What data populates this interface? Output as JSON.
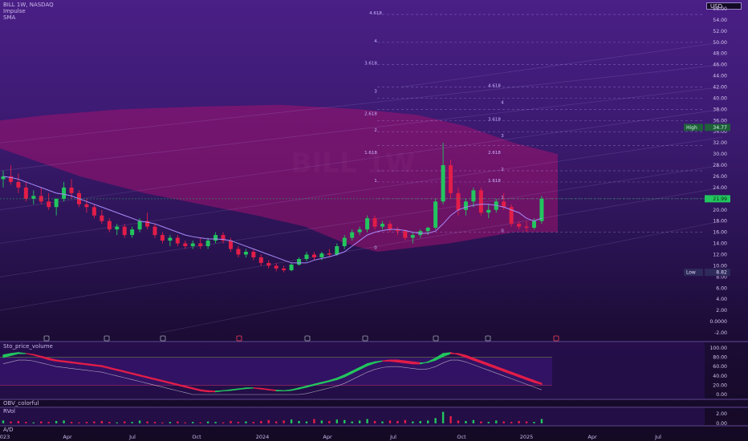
{
  "header": {
    "symbol": "BILL 1W, NASDAQ",
    "indicator1": "Impulse",
    "indicator2": "SMA",
    "currency": "USD"
  },
  "watermark": "BILL 1W",
  "colors": {
    "up": "#22c55e",
    "down": "#e11d48",
    "sma": "#a78bfa",
    "cloud": "#a1126f",
    "high_tag": "#1f5f3a",
    "last_tag": "#22c55e",
    "low_tag": "#2e2a5a"
  },
  "chart_data": [
    {
      "type": "candlestick",
      "title": "BILL 1W, NASDAQ",
      "ylim": [
        -2,
        56
      ],
      "y_ticks": [
        "56.00",
        "54.00",
        "52.00",
        "50.00",
        "48.00",
        "46.00",
        "44.00",
        "42.00",
        "40.00",
        "38.00",
        "36.00",
        "34.00",
        "32.00",
        "30.00",
        "28.00",
        "26.00",
        "24.00",
        "22.00",
        "20.00",
        "18.00",
        "16.00",
        "14.00",
        "12.00",
        "10.00",
        "8.00",
        "6.00",
        "4.00",
        "2.00",
        "0.0000",
        "-2.00"
      ],
      "x_ticks": [
        "023",
        "Apr",
        "Jul",
        "Oct",
        "2024",
        "Apr",
        "Jul",
        "Oct",
        "2025",
        "Apr",
        "Jul"
      ],
      "high": {
        "label": "High",
        "value": "34.77"
      },
      "last": {
        "value": "21.99"
      },
      "low": {
        "label": "Low",
        "value": "8.82"
      },
      "fib_labels": [
        "4.618",
        "4",
        "3.618",
        "3",
        "2.618",
        "2",
        "1.618",
        "1",
        "0",
        "4.618",
        "4",
        "3.618",
        "3",
        "2.618",
        "2",
        "1.618",
        "1",
        "0"
      ],
      "series": [
        {
          "name": "Price",
          "ohlc": [
            [
              25.5,
              27,
              24,
              26
            ],
            [
              26,
              28,
              24.5,
              25
            ],
            [
              25,
              26.5,
              23,
              24
            ],
            [
              24,
              25,
              21.5,
              22
            ],
            [
              22,
              23.5,
              21,
              22.5
            ],
            [
              22.5,
              24,
              21,
              21.5
            ],
            [
              21.5,
              23,
              20,
              20.5
            ],
            [
              20.5,
              22,
              19,
              22
            ],
            [
              22,
              25,
              21.5,
              24
            ],
            [
              24,
              25.5,
              22,
              23
            ],
            [
              23,
              23.5,
              20.5,
              21
            ],
            [
              21,
              22,
              19.5,
              20.5
            ],
            [
              20.5,
              21,
              18.5,
              19
            ],
            [
              19,
              20,
              17.5,
              18
            ],
            [
              18,
              18.5,
              16,
              16.5
            ],
            [
              16.5,
              17.5,
              15.5,
              17
            ],
            [
              17,
              17.5,
              15,
              15.5
            ],
            [
              15.5,
              17,
              15,
              16.5
            ],
            [
              16.5,
              18.5,
              16,
              18
            ],
            [
              18,
              19.5,
              16.5,
              17
            ],
            [
              17,
              17.5,
              15,
              15.5
            ],
            [
              15.5,
              16,
              14,
              14.5
            ],
            [
              14.5,
              15.5,
              13.5,
              15
            ],
            [
              15,
              15.5,
              13.5,
              14
            ],
            [
              14,
              14.5,
              13,
              13.5
            ],
            [
              13.5,
              14.5,
              13,
              14
            ],
            [
              14,
              15,
              13,
              13.5
            ],
            [
              13.5,
              15,
              13,
              14.5
            ],
            [
              14.5,
              16,
              14,
              15.5
            ],
            [
              15.5,
              16,
              14,
              14.5
            ],
            [
              14.5,
              15,
              12.5,
              13
            ],
            [
              13,
              13.5,
              11.5,
              12
            ],
            [
              12,
              13,
              11.5,
              12.5
            ],
            [
              12.5,
              13,
              11,
              11.5
            ],
            [
              11.5,
              12,
              10,
              10.5
            ],
            [
              10.5,
              11,
              9.5,
              10
            ],
            [
              10,
              10.5,
              9,
              9.5
            ],
            [
              9.5,
              10,
              8.82,
              9.2
            ],
            [
              9.2,
              10.5,
              9,
              10.2
            ],
            [
              10.2,
              11.5,
              10,
              11.2
            ],
            [
              11.2,
              12.5,
              10.8,
              12
            ],
            [
              12,
              12.5,
              11,
              11.5
            ],
            [
              11.5,
              12.5,
              11,
              12.2
            ],
            [
              12.2,
              13,
              11.5,
              12
            ],
            [
              12,
              14,
              11.8,
              13.5
            ],
            [
              13.5,
              15.5,
              13,
              15
            ],
            [
              15,
              16.5,
              14.5,
              16
            ],
            [
              16,
              17,
              15.5,
              16.5
            ],
            [
              16.5,
              19,
              16,
              18.5
            ],
            [
              18.5,
              19,
              16.5,
              17
            ],
            [
              17,
              18,
              16.5,
              17.5
            ],
            [
              17.5,
              18,
              16,
              16.5
            ],
            [
              16.5,
              17,
              15.5,
              16.2
            ],
            [
              16.2,
              16.5,
              14.5,
              15
            ],
            [
              15,
              16,
              14,
              15.5
            ],
            [
              15.5,
              16.5,
              15,
              16.2
            ],
            [
              16.2,
              17,
              15.5,
              16.8
            ],
            [
              16.8,
              22,
              16.5,
              21.5
            ],
            [
              21.5,
              32,
              21,
              28
            ],
            [
              28,
              29,
              22,
              23
            ],
            [
              23,
              24,
              19,
              20
            ],
            [
              20,
              22,
              19,
              21.5
            ],
            [
              21.5,
              24,
              20.5,
              23.5
            ],
            [
              23.5,
              24,
              19,
              19.5
            ],
            [
              19.5,
              21,
              18.5,
              20
            ],
            [
              20,
              22,
              19.5,
              21.5
            ],
            [
              21.5,
              23,
              20,
              20.5
            ],
            [
              20.5,
              21,
              17,
              17.5
            ],
            [
              17.5,
              18,
              16.5,
              17
            ],
            [
              17,
              18,
              16,
              16.8
            ],
            [
              16.8,
              18.5,
              16.5,
              18
            ],
            [
              18,
              22.5,
              17.5,
              21.99
            ]
          ]
        },
        {
          "name": "SMA",
          "values": [
            26,
            25.8,
            25.5,
            25,
            24.5,
            24,
            23.5,
            23,
            22.8,
            22.5,
            22,
            21.5,
            21,
            20.5,
            20,
            19.5,
            19,
            18.5,
            18,
            17.8,
            17.5,
            17,
            16.5,
            16,
            15.5,
            15.2,
            15,
            14.8,
            14.8,
            14.7,
            14.5,
            14,
            13.5,
            13,
            12.5,
            12,
            11.5,
            11,
            10.5,
            10.5,
            10.5,
            11,
            11.3,
            11.6,
            12,
            12.5,
            13.5,
            14.5,
            15.5,
            16,
            16.3,
            16.5,
            16.5,
            16.3,
            16,
            15.8,
            15.8,
            16.2,
            17.5,
            19,
            20,
            20.5,
            20.8,
            21,
            21,
            20.8,
            20.5,
            20,
            19.5,
            18.5,
            18,
            18.5
          ]
        }
      ]
    },
    {
      "type": "line",
      "title": "Sto_price_volume",
      "ylim": [
        0,
        100
      ],
      "y_ticks": [
        "100.00",
        "80.00",
        "60.00",
        "40.00",
        "20.00",
        "0.00"
      ],
      "series": [
        {
          "name": "K",
          "values": [
            85,
            88,
            90,
            88,
            85,
            80,
            75,
            72,
            70,
            68,
            66,
            64,
            62,
            60,
            56,
            52,
            48,
            44,
            40,
            36,
            32,
            28,
            24,
            20,
            16,
            12,
            8,
            6,
            6,
            8,
            10,
            12,
            14,
            14,
            12,
            10,
            8,
            8,
            10,
            14,
            18,
            22,
            26,
            30,
            35,
            42,
            50,
            58,
            66,
            70,
            72,
            72,
            70,
            68,
            66,
            66,
            70,
            78,
            88,
            90,
            86,
            80,
            74,
            68,
            62,
            56,
            50,
            44,
            38,
            32,
            26,
            22
          ]
        },
        {
          "name": "D",
          "values": [
            80,
            84,
            88,
            88,
            86,
            82,
            78,
            74,
            72,
            70,
            68,
            66,
            64,
            62,
            58,
            54,
            50,
            46,
            42,
            38,
            34,
            30,
            26,
            22,
            18,
            14,
            10,
            8,
            7,
            8,
            9,
            11,
            13,
            14,
            13,
            11,
            9,
            8,
            9,
            12,
            16,
            20,
            24,
            28,
            32,
            38,
            46,
            54,
            62,
            68,
            72,
            74,
            74,
            72,
            70,
            68,
            69,
            74,
            82,
            88,
            88,
            84,
            78,
            72,
            66,
            60,
            54,
            48,
            42,
            36,
            30,
            24
          ]
        }
      ]
    },
    {
      "type": "line",
      "title": "OBV_colorful",
      "series": []
    },
    {
      "type": "bar",
      "title": "RVol",
      "ylim": [
        0,
        3
      ],
      "y_ticks": [
        "2.00",
        "0.00"
      ],
      "series": [
        {
          "name": "RVol",
          "values": [
            0.6,
            0.4,
            0.5,
            0.3,
            0.2,
            0.4,
            0.3,
            0.5,
            0.6,
            0.3,
            0.2,
            0.3,
            0.4,
            0.5,
            0.3,
            0.2,
            0.4,
            0.3,
            0.6,
            0.4,
            0.3,
            0.2,
            0.3,
            0.4,
            0.2,
            0.3,
            0.2,
            0.4,
            0.3,
            0.2,
            0.5,
            0.3,
            0.4,
            0.3,
            0.5,
            0.7,
            0.4,
            0.6,
            0.8,
            0.5,
            0.4,
            0.9,
            0.6,
            0.5,
            0.8,
            0.7,
            0.4,
            0.6,
            0.9,
            0.5,
            0.4,
            0.6,
            0.5,
            0.7,
            0.4,
            0.5,
            0.6,
            1.1,
            2.4,
            1.5,
            0.6,
            0.5,
            0.7,
            0.4,
            0.3,
            0.6,
            0.4,
            0.3,
            0.5,
            0.4,
            0.3,
            0.9
          ]
        }
      ]
    },
    {
      "type": "line",
      "title": "A/D",
      "series": []
    }
  ]
}
